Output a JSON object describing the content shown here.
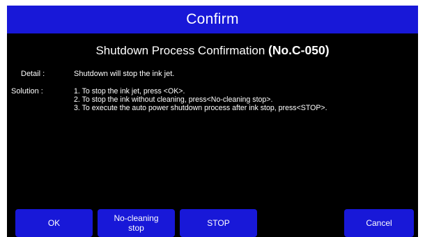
{
  "dialog": {
    "title": "Confirm",
    "heading": "Shutdown Process Confirmation",
    "code": "(No.C-050)",
    "detail_label": "Detail :",
    "detail_text": "Shutdown will stop the ink jet.",
    "solution_label": "Solution :",
    "solution_steps": [
      "1. To stop the ink jet, press <OK>.",
      "2. To stop the ink without cleaning, press<No-cleaning stop>.",
      "3. To execute the auto power shutdown process after ink stop, press<STOP>."
    ]
  },
  "buttons": {
    "ok": "OK",
    "no_cleaning_stop": "No-cleaning stop",
    "stop": "STOP",
    "cancel": "Cancel"
  },
  "colors": {
    "accent": "#1818d8",
    "background": "#000000",
    "text": "#ffffff"
  }
}
